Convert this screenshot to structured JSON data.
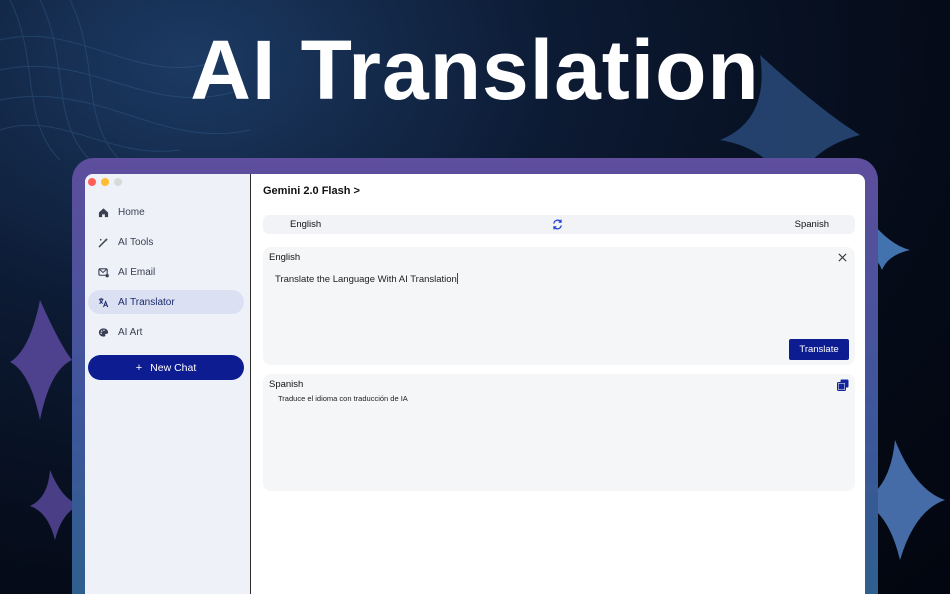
{
  "hero": {
    "title": "AI Translation"
  },
  "window": {
    "traffic_colors": [
      "#ff5f57",
      "#febc2e",
      "#d9d9d9"
    ]
  },
  "sidebar": {
    "items": [
      {
        "label": "Home",
        "icon": "home-icon",
        "active": false
      },
      {
        "label": "AI Tools",
        "icon": "magic-wand-icon",
        "active": false
      },
      {
        "label": "AI Email",
        "icon": "email-icon",
        "active": false
      },
      {
        "label": "AI Translator",
        "icon": "translate-icon",
        "active": true
      },
      {
        "label": "AI Art",
        "icon": "palette-icon",
        "active": false
      }
    ],
    "new_chat": {
      "plus": "+",
      "label": "New Chat"
    }
  },
  "main": {
    "model_title": "Gemini 2.0 Flash >",
    "lang_bar": {
      "source": "English",
      "target": "Spanish",
      "swap_icon": "swap-icon"
    },
    "input_card": {
      "label": "English",
      "text": "Translate the Language With AI Translation",
      "translate_label": "Translate"
    },
    "output_card": {
      "label": "Spanish",
      "text": "Traduce el idioma con traducción de IA"
    }
  },
  "colors": {
    "accent": "#0e1c92",
    "active_bg": "#dbe1f3",
    "sidebar_bg": "#eef1f8"
  }
}
